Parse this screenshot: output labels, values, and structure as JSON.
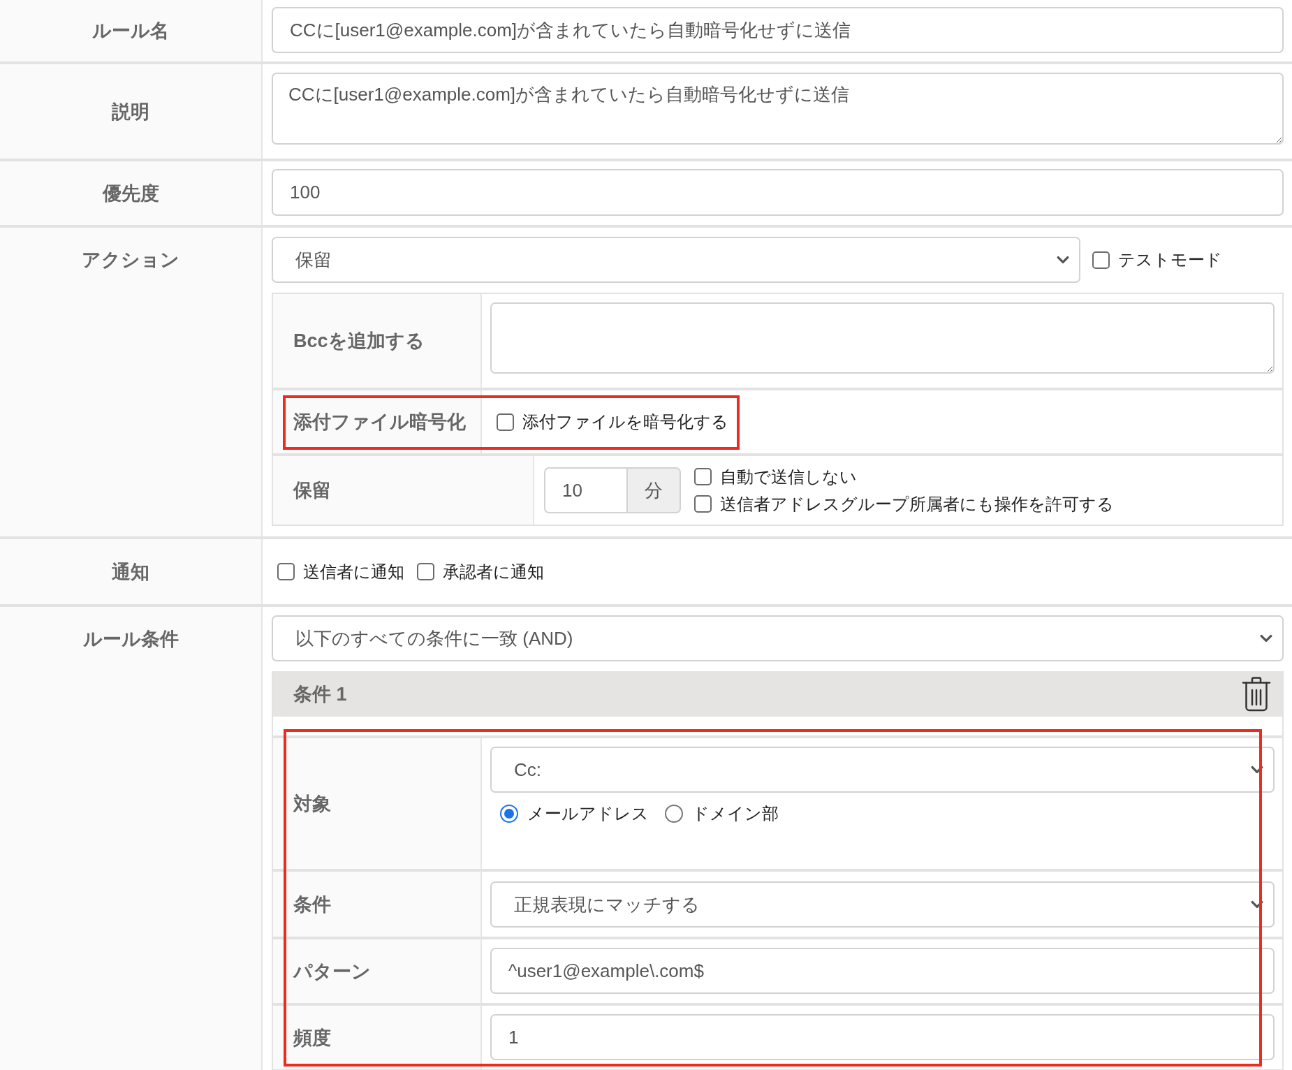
{
  "rows": [
    {
      "kind": "text",
      "label": "ルール名",
      "value": "CCに[user1@example.com]が含まれていたら自動暗号化せずに送信"
    },
    {
      "kind": "textarea",
      "label": "説明",
      "value": "CCに[user1@example.com]が含まれていたら自動暗号化せずに送信"
    },
    {
      "kind": "text",
      "label": "優先度",
      "value": "100"
    },
    {
      "kind": "action",
      "label": "アクション",
      "select": "保留",
      "test_mode": {
        "label": "テストモード",
        "checked": false
      },
      "settings": [
        {
          "kind": "textarea",
          "label": "Bccを追加する"
        },
        {
          "kind": "checkbox",
          "label": "添付ファイル暗号化",
          "option": {
            "label": "添付ファイルを暗号化する",
            "checked": false
          },
          "highlighted": true
        },
        {
          "kind": "hold",
          "label": "保留",
          "minutes": "10",
          "unit": "分",
          "options": [
            {
              "label": "自動で送信しない",
              "checked": false
            },
            {
              "label": "送信者アドレスグループ所属者にも操作を許可する",
              "checked": false
            }
          ]
        }
      ]
    },
    {
      "kind": "checkboxes",
      "label": "通知",
      "options": [
        {
          "label": "送信者に通知",
          "checked": false
        },
        {
          "label": "承認者に通知",
          "checked": false
        }
      ]
    },
    {
      "kind": "conditions",
      "label": "ルール条件",
      "match": "以下のすべての条件に一致 (AND)",
      "conditions": [
        {
          "title": "条件 1",
          "highlighted": true,
          "fields": [
            {
              "kind": "target",
              "label": "対象",
              "select": "Cc:",
              "radios": [
                {
                  "label": "メールアドレス",
                  "selected": true
                },
                {
                  "label": "ドメイン部",
                  "selected": false
                }
              ]
            },
            {
              "kind": "select",
              "label": "条件",
              "value": "正規表現にマッチする"
            },
            {
              "kind": "text",
              "label": "パターン",
              "value": "^user1@example\\.com$"
            },
            {
              "kind": "text",
              "label": "頻度",
              "value": "1"
            }
          ]
        }
      ]
    }
  ]
}
